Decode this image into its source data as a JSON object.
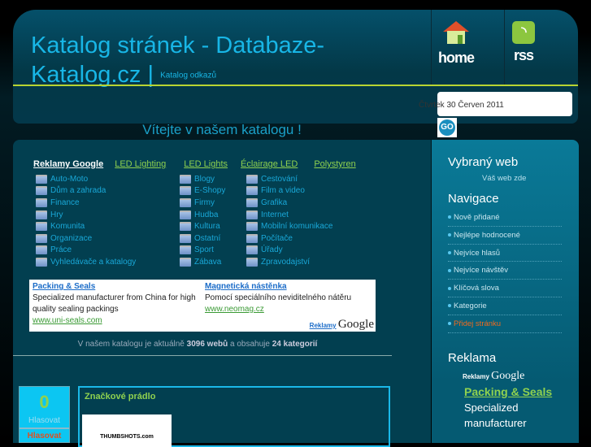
{
  "header": {
    "title": "Katalog stránek - Databaze-Katalog.cz",
    "separator": "|",
    "subtitle": "Katalog odkazů",
    "home_label": "home",
    "rss_label": "rss",
    "date": "Čtvrtek 30 Červen 2011",
    "go_label": "GO",
    "search_value": ""
  },
  "welcome": "Vítejte v našem katalogu !",
  "links": [
    "Reklamy Google",
    "LED Lighting",
    "LED Lights",
    "Éclairage LED",
    "Polystyren"
  ],
  "categories": {
    "col1": [
      "Auto-Moto",
      "Dům a zahrada",
      "Finance",
      "Hry",
      "Komunita",
      "Organizace",
      "Práce",
      "Vyhledávače a katalogy"
    ],
    "col2": [
      "Blogy",
      "E-Shopy",
      "Firmy",
      "Hudba",
      "Kultura",
      "Ostatní",
      "Sport",
      "Zábava"
    ],
    "col3": [
      "Cestování",
      "Film a video",
      "Grafika",
      "Internet",
      "Mobilní komunikace",
      "Počítače",
      "Úřady",
      "Zpravodajství"
    ]
  },
  "ad": {
    "a1": {
      "title": "Packing & Seals",
      "text": "Specialized manufacturer from China for high quality sealing packings",
      "url": "www.uni-seals.com"
    },
    "a2": {
      "title": "Magnetická nástěnka",
      "text": "Pomocí speciálního neviditelného nátěru",
      "url": "www.neomag.cz"
    },
    "reklamy": "Reklamy",
    "google": "Google"
  },
  "stats": {
    "prefix": "V našem katalogu je aktuálně",
    "webs": "3096 webů",
    "middle": "a obsahuje",
    "cats": "24 kategorií"
  },
  "entry": {
    "votes": "0",
    "vote_label": "Hlasovat",
    "vote_button": "Hlasovat",
    "title": "Značkové prádlo",
    "thumb": "THUMBSHOTS.com"
  },
  "sidebar": {
    "featured_title": "Vybraný web",
    "featured_text": "Váš web zde",
    "nav_title": "Navigace",
    "nav": [
      "Nově přidané",
      "Nejlépe hodnocené",
      "Nejvíce hlasů",
      "Nejvíce návštěv",
      "Klíčová slova",
      "Kategorie",
      "Přidej stránku"
    ],
    "ads_title": "Reklama",
    "ads_reklamy": "Reklamy",
    "ads_google": "Google",
    "ad_title": "Packing & Seals",
    "ad_text": "Specialized manufacturer"
  }
}
